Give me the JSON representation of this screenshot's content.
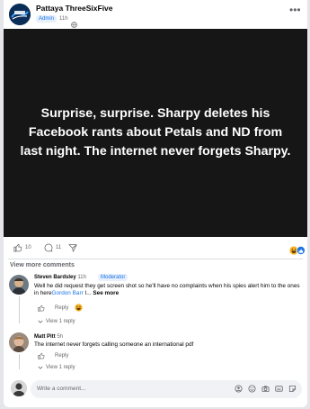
{
  "post": {
    "page_name": "Pattaya ThreeSixFive",
    "admin_badge": "Admin",
    "time": "11h",
    "image_text": "Surprise, surprise. Sharpy deletes his Facebook rants about Petals and ND from last night. The internet never forgets Sharpy."
  },
  "actions": {
    "like_count": "10",
    "comment_count": "11"
  },
  "view_more_comments": "View more comments",
  "comments": [
    {
      "author": "Steven Bardsley",
      "time": "11h",
      "badge": "Moderator",
      "text": "Well he did request they get screen shot so he'll have no complaints when his spies alert him to the ones in here",
      "mention": "Gordon Barr",
      "ellipsis": " I...",
      "see_more": "See more",
      "reply_label": "Reply",
      "view_reply": "View 1 reply"
    },
    {
      "author": "Matt Pitt",
      "time": "5h",
      "text": "The internet never forgets calling someone an international pdf",
      "reply_label": "Reply",
      "view_reply": "View 1 reply"
    }
  ],
  "write_comment": {
    "placeholder": "Write a comment..."
  },
  "colors": {
    "accent": "#1b74e4",
    "post_bg": "#161616",
    "page_bg": "#e4e6ea"
  },
  "icons": [
    "page-logo",
    "globe-icon",
    "more-icon",
    "like-icon",
    "comment-icon",
    "share-icon",
    "haha-reaction-icon",
    "like-reaction-icon",
    "reply-like-icon",
    "reply-arrow-icon",
    "sticker-icon",
    "emoji-icon",
    "camera-icon",
    "gif-icon",
    "avatar-sticker-icon"
  ]
}
